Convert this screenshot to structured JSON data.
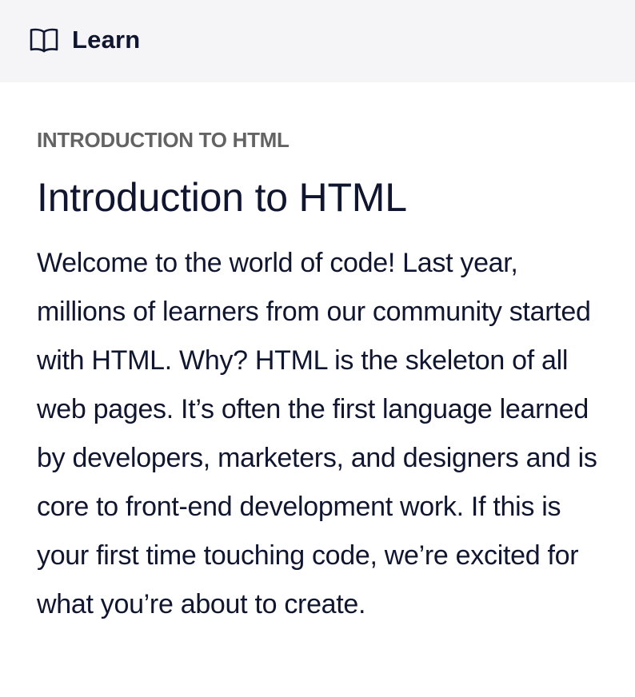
{
  "header": {
    "icon": "book-icon",
    "link_label": "Learn"
  },
  "main": {
    "breadcrumb": "INTRODUCTION TO HTML",
    "title": "Introduction to HTML",
    "description": "Welcome to the world of code! Last year, millions of learners from our community started with HTML. Why? HTML is the skeleton of all web pages. It’s often the first language learned by developers, marketers, and designers and is core to front-end development work. If this is your first time touching code, we’re excited for what you’re about to create."
  },
  "colors": {
    "header_bg": "#f5f5f7",
    "text_primary": "#10162f",
    "text_muted": "#636363",
    "page_bg": "#ffffff"
  }
}
